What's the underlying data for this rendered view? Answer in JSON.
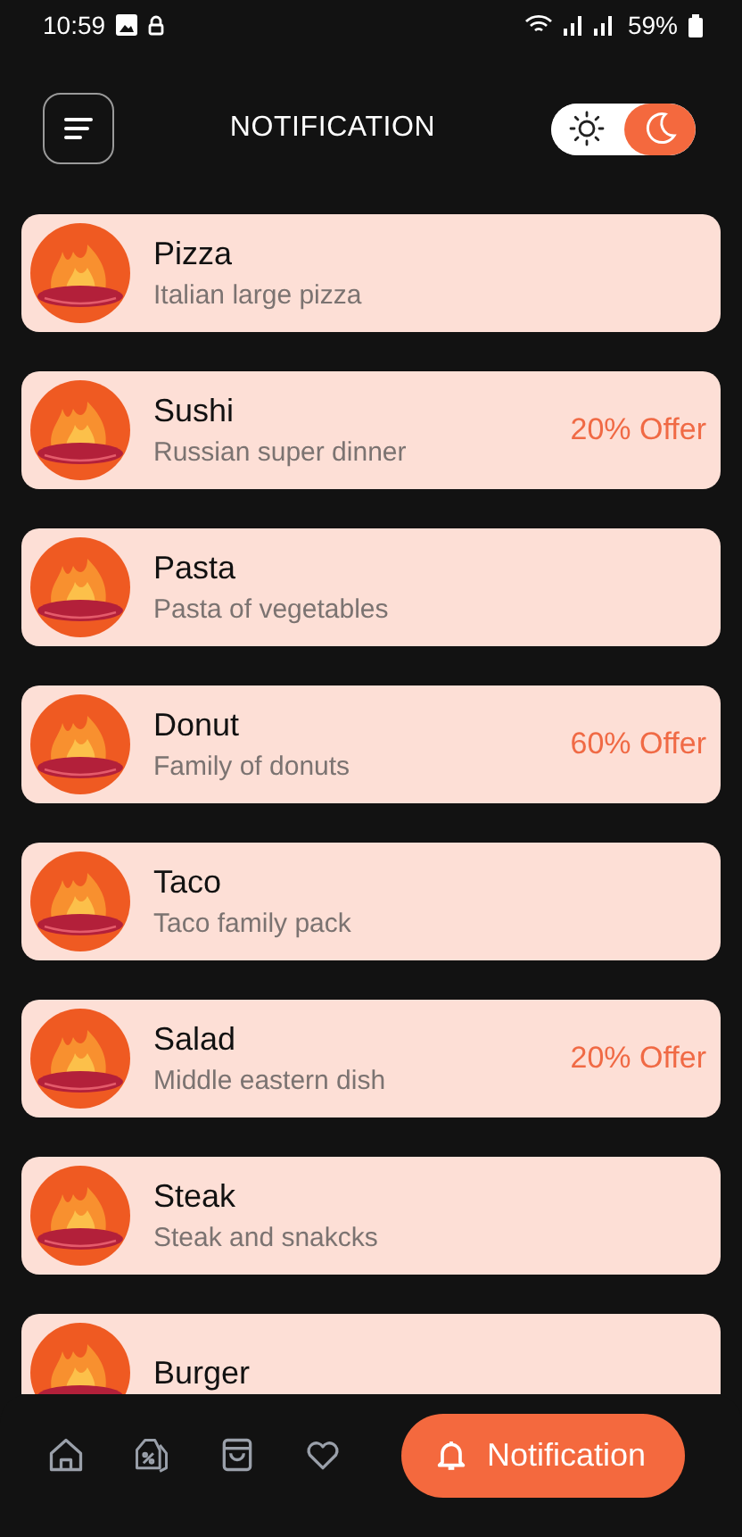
{
  "status_bar": {
    "time": "10:59",
    "battery": "59%"
  },
  "header": {
    "title": "NOTIFICATION",
    "theme_toggle": [
      {
        "kind": "sun",
        "selected": false
      },
      {
        "kind": "moon",
        "selected": true
      }
    ]
  },
  "items": [
    {
      "name": "Pizza",
      "description": "Italian large pizza"
    },
    {
      "name": "Sushi",
      "description": "Russian super dinner",
      "offer": "20% Offer"
    },
    {
      "name": "Pasta",
      "description": "Pasta of vegetables"
    },
    {
      "name": "Donut",
      "description": "Family of donuts",
      "offer": "60% Offer"
    },
    {
      "name": "Taco",
      "description": "Taco family pack"
    },
    {
      "name": "Salad",
      "description": "Middle eastern dish",
      "offer": "20% Offer"
    },
    {
      "name": "Steak",
      "description": "Steak and snakcks"
    },
    {
      "name": "Burger"
    }
  ],
  "bottom_nav": [
    {
      "kind": "home",
      "selected": false
    },
    {
      "kind": "discount",
      "selected": false
    },
    {
      "kind": "bag",
      "selected": false
    },
    {
      "kind": "heart",
      "selected": false
    },
    {
      "kind": "bell",
      "label": "Notification",
      "selected": true
    }
  ]
}
